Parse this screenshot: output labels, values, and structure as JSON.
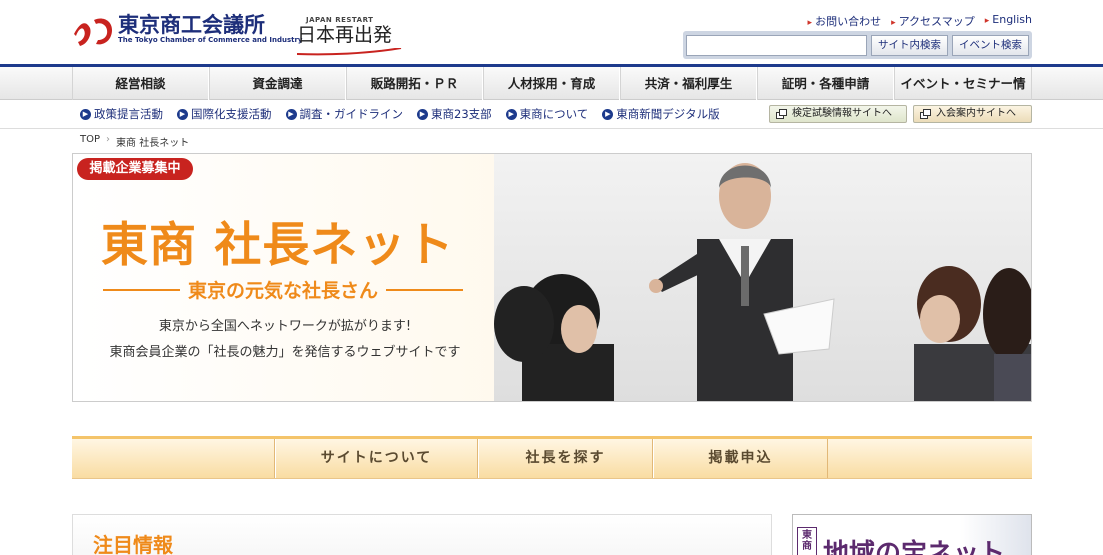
{
  "header": {
    "logo_jp": "東京商工会議所",
    "logo_en": "The Tokyo Chamber of Commerce and Industry",
    "restart_en": "JAPAN RESTART",
    "restart_jp": "日本再出発",
    "links": [
      "お問い合わせ",
      "アクセスマップ",
      "English"
    ],
    "search_placeholder": "",
    "site_search_label": "サイト内検索",
    "event_search_label": "イベント検索"
  },
  "mainnav": [
    "経営相談",
    "資金調達",
    "販路開拓・ＰＲ",
    "人材採用・育成",
    "共済・福利厚生",
    "証明・各種申請",
    "イベント・セミナー情報"
  ],
  "subnav": [
    "政策提言活動",
    "国際化支援活動",
    "調査・ガイドライン",
    "東商23支部",
    "東商について",
    "東商新聞デジタル版"
  ],
  "ext_buttons": [
    "検定試験情報サイトへ",
    "入会案内サイトへ"
  ],
  "breadcrumb": {
    "home": "TOP",
    "current": "東商 社長ネット"
  },
  "hero": {
    "badge": "掲載企業募集中",
    "title": "東商 社長ネット",
    "subtitle": "東京の元気な社長さん",
    "desc1": "東京から全国へネットワークが拡がります!",
    "desc2": "東商会員企業の「社長の魅力」を発信するウェブサイトです"
  },
  "tabs": [
    "サイトについて",
    "社長を探す",
    "掲載申込"
  ],
  "notice_title": "注目情報",
  "region": {
    "tag": "東商",
    "title": "地域の宝ネット"
  },
  "colors": {
    "navy": "#1d2e7a",
    "orange": "#ef8a1a",
    "red": "#c8231f"
  }
}
